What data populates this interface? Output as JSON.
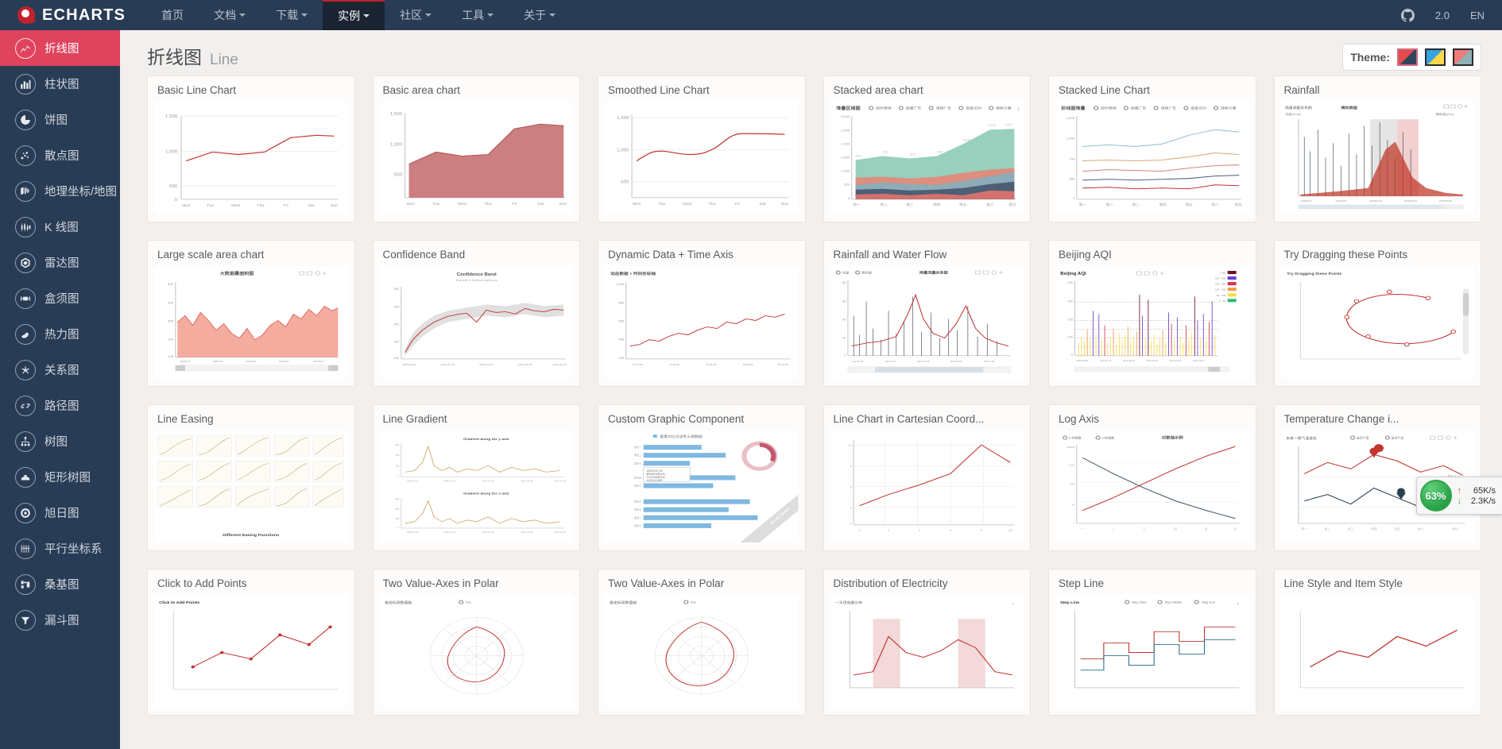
{
  "navbar": {
    "brand": "ECHARTS",
    "items": [
      {
        "label": "首页",
        "caret": false,
        "active": false
      },
      {
        "label": "文档",
        "caret": true,
        "active": false
      },
      {
        "label": "下载",
        "caret": true,
        "active": false
      },
      {
        "label": "实例",
        "caret": true,
        "active": true
      },
      {
        "label": "社区",
        "caret": true,
        "active": false
      },
      {
        "label": "工具",
        "caret": true,
        "active": false
      },
      {
        "label": "关于",
        "caret": true,
        "active": false
      }
    ],
    "right": {
      "github_icon": "github-icon",
      "version": "2.0",
      "lang": "EN"
    }
  },
  "sidebar": {
    "items": [
      {
        "label": "折线图",
        "icon": "line-chart-icon",
        "active": true
      },
      {
        "label": "柱状图",
        "icon": "bar-chart-icon",
        "active": false
      },
      {
        "label": "饼图",
        "icon": "pie-chart-icon",
        "active": false
      },
      {
        "label": "散点图",
        "icon": "scatter-chart-icon",
        "active": false
      },
      {
        "label": "地理坐标/地图",
        "icon": "map-icon",
        "active": false
      },
      {
        "label": "K 线图",
        "icon": "candlestick-icon",
        "active": false
      },
      {
        "label": "雷达图",
        "icon": "radar-icon",
        "active": false
      },
      {
        "label": "盒须图",
        "icon": "boxplot-icon",
        "active": false
      },
      {
        "label": "热力图",
        "icon": "heatmap-icon",
        "active": false
      },
      {
        "label": "关系图",
        "icon": "graph-icon",
        "active": false
      },
      {
        "label": "路径图",
        "icon": "lines-icon",
        "active": false
      },
      {
        "label": "树图",
        "icon": "tree-icon",
        "active": false
      },
      {
        "label": "矩形树图",
        "icon": "treemap-icon",
        "active": false
      },
      {
        "label": "旭日图",
        "icon": "sunburst-icon",
        "active": false
      },
      {
        "label": "平行坐标系",
        "icon": "parallel-icon",
        "active": false
      },
      {
        "label": "桑基图",
        "icon": "sankey-icon",
        "active": false
      },
      {
        "label": "漏斗图",
        "icon": "funnel-icon",
        "active": false
      }
    ]
  },
  "page": {
    "title_cn": "折线图",
    "title_en": "Line",
    "theme_label": "Theme:",
    "themes": [
      {
        "name": "theme-swatch-red",
        "selected": true
      },
      {
        "name": "theme-swatch-blue",
        "selected": false
      },
      {
        "name": "theme-swatch-pink",
        "selected": false
      }
    ]
  },
  "netspeed": {
    "percent": "63%",
    "up_arrow": "↑",
    "up_value": "65K/s",
    "down_arrow": "↓",
    "down_value": "2.3K/s"
  },
  "gallery": {
    "cards": [
      {
        "title": "Basic Line Chart",
        "kind": "line"
      },
      {
        "title": "Basic area chart",
        "kind": "area"
      },
      {
        "title": "Smoothed Line Chart",
        "kind": "smooth"
      },
      {
        "title": "Stacked area chart",
        "kind": "stacked-area"
      },
      {
        "title": "Stacked Line Chart",
        "kind": "stacked-line"
      },
      {
        "title": "Rainfall",
        "kind": "rainfall"
      },
      {
        "title": "Large scale area chart",
        "kind": "large-area"
      },
      {
        "title": "Confidence Band",
        "kind": "confidence"
      },
      {
        "title": "Dynamic Data + Time Axis",
        "kind": "dynamic"
      },
      {
        "title": "Rainfall and Water Flow",
        "kind": "rain-water"
      },
      {
        "title": "Beijing AQI",
        "kind": "aqi"
      },
      {
        "title": "Try Dragging these Points",
        "kind": "drag"
      },
      {
        "title": "Line Easing",
        "kind": "easing"
      },
      {
        "title": "Line Gradient",
        "kind": "gradient"
      },
      {
        "title": "Custom Graphic Component",
        "kind": "custom-graphic"
      },
      {
        "title": "Line Chart in Cartesian Coord...",
        "kind": "cartesian"
      },
      {
        "title": "Log Axis",
        "kind": "log"
      },
      {
        "title": "Temperature Change i...",
        "kind": "temperature"
      },
      {
        "title": "Click to Add Points",
        "kind": "click-add"
      },
      {
        "title": "Two Value-Axes in Polar",
        "kind": "polar"
      },
      {
        "title": "Two Value-Axes in Polar",
        "kind": "polar"
      },
      {
        "title": "Distribution of Electricity",
        "kind": "electricity"
      },
      {
        "title": "Step Line",
        "kind": "step"
      },
      {
        "title": "Line Style and Item Style",
        "kind": "linestyle"
      }
    ]
  },
  "chart_data": {
    "type": "line",
    "title": "Basic Line Chart",
    "categories": [
      "Mon",
      "Tue",
      "Wed",
      "Thu",
      "Fri",
      "Sat",
      "Sun"
    ],
    "values": [
      820,
      932,
      901,
      934,
      1290,
      1330,
      1320
    ],
    "ylim": [
      0,
      1500
    ],
    "yticks": [
      0,
      500,
      1000,
      1500
    ],
    "xlabel": "",
    "ylabel": "",
    "grid": true,
    "legend": null,
    "stacked_area": {
      "type": "area",
      "title": "堆叠区域图",
      "legend": [
        "邮件营销",
        "联盟广告",
        "视频广告",
        "直接访问",
        "搜索引擎"
      ],
      "categories": [
        "周一",
        "周二",
        "周三",
        "周四",
        "周五",
        "周六",
        "周日"
      ],
      "series": [
        {
          "name": "邮件营销",
          "values": [
            120,
            132,
            101,
            134,
            90,
            230,
            210
          ]
        },
        {
          "name": "联盟广告",
          "values": [
            220,
            182,
            191,
            234,
            290,
            330,
            310
          ]
        },
        {
          "name": "视频广告",
          "values": [
            150,
            232,
            201,
            154,
            190,
            330,
            410
          ]
        },
        {
          "name": "直接访问",
          "values": [
            320,
            332,
            301,
            334,
            390,
            330,
            320
          ]
        },
        {
          "name": "搜索引擎",
          "values": [
            820,
            932,
            901,
            934,
            1290,
            1330,
            1320
          ]
        }
      ],
      "ylim": [
        0,
        3000
      ],
      "yticks": [
        0,
        500,
        1000,
        1500,
        2000,
        2500,
        3000
      ]
    },
    "beijing_aqi": {
      "type": "line",
      "title": "Beijing AQI",
      "ylim": [
        0,
        400
      ],
      "yticks": [
        0,
        100,
        200,
        300,
        400
      ],
      "xticks": [
        "2014-06-05",
        "2014-07-11",
        "2014-08-16",
        "2014-09-21",
        "2014-10-26",
        "2014-12-01",
        "2015-01-22"
      ],
      "legend_pieces": [
        "0 - 50",
        "50 - 100",
        "100 - 150",
        "150 - 200",
        "200 - 300",
        "> 300"
      ],
      "legend_colors": [
        "#2eb872",
        "#fdd84a",
        "#f2994a",
        "#d0364b",
        "#6a3fd6",
        "#6b1027"
      ],
      "marklines": [
        50,
        100,
        150,
        200,
        300
      ]
    }
  }
}
